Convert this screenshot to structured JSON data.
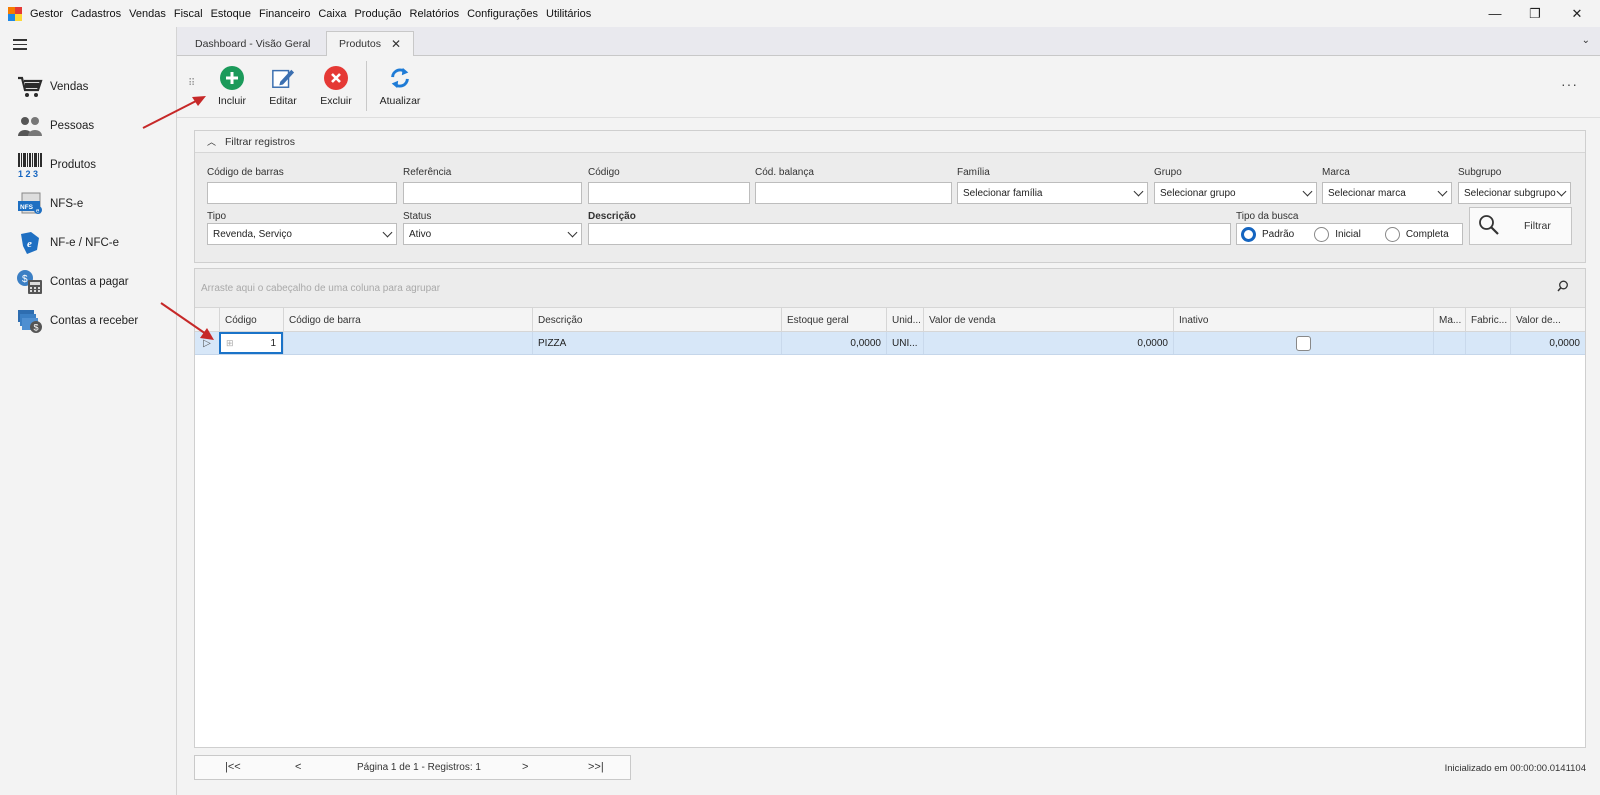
{
  "menubar": {
    "items": [
      "Gestor",
      "Cadastros",
      "Vendas",
      "Fiscal",
      "Estoque",
      "Financeiro",
      "Caixa",
      "Produção",
      "Relatórios",
      "Configurações",
      "Utilitários"
    ],
    "minimize": "—",
    "restore": "❐",
    "close": "✕"
  },
  "sidebar": {
    "items": [
      {
        "label": "Vendas",
        "icon": "shopping-cart-icon"
      },
      {
        "label": "Pessoas",
        "icon": "people-icon"
      },
      {
        "label": "Produtos",
        "icon": "barcode-icon"
      },
      {
        "label": "NFS-e",
        "icon": "nfse-icon"
      },
      {
        "label": "NF-e / NFC-e",
        "icon": "nfe-icon"
      },
      {
        "label": "Contas a pagar",
        "icon": "bill-pay-icon"
      },
      {
        "label": "Contas a receber",
        "icon": "bill-receive-icon"
      }
    ]
  },
  "tabs": {
    "items": [
      {
        "label": "Dashboard - Visão Geral",
        "active": false
      },
      {
        "label": "Produtos",
        "active": true,
        "close": "✕"
      }
    ],
    "dropdown": "⌄"
  },
  "toolbar": {
    "incluir": "Incluir",
    "editar": "Editar",
    "excluir": "Excluir",
    "atualizar": "Atualizar",
    "more": "···"
  },
  "filter": {
    "header": "Filtrar registros",
    "codigo_barras_label": "Código de barras",
    "codigo_barras_value": "",
    "referencia_label": "Referência",
    "referencia_value": "",
    "codigo_label": "Código",
    "codigo_value": "",
    "cod_balanca_label": "Cód. balança",
    "cod_balanca_value": "",
    "familia_label": "Família",
    "familia_value": "Selecionar família",
    "grupo_label": "Grupo",
    "grupo_value": "Selecionar grupo",
    "marca_label": "Marca",
    "marca_value": "Selecionar marca",
    "subgrupo_label": "Subgrupo",
    "subgrupo_value": "Selecionar subgrupo",
    "tipo_label": "Tipo",
    "tipo_value": "Revenda, Serviço",
    "status_label": "Status",
    "status_value": "Ativo",
    "descricao_label": "Descrição",
    "descricao_value": "",
    "tipo_busca_label": "Tipo da busca",
    "tipo_busca_options": [
      "Padrão",
      "Inicial",
      "Completa"
    ],
    "tipo_busca_selected": "Padrão",
    "filtrar_label": "Filtrar"
  },
  "grid": {
    "group_hint": "Arraste aqui o cabeçalho de uma coluna para agrupar",
    "columns": [
      "Código",
      "Código de barra",
      "Descrição",
      "Estoque geral",
      "Unid...",
      "Valor de venda",
      "Inativo",
      "Ma...",
      "Fabric...",
      "Valor de..."
    ],
    "rows": [
      {
        "codigo": "1",
        "codigo_barra": "",
        "descricao": "PIZZA",
        "estoque_geral": "0,0000",
        "unidade": "UNI...",
        "valor_venda": "0,0000",
        "inativo": false,
        "marca": "",
        "fabricante": "",
        "valor_de": "0,0000"
      }
    ]
  },
  "pager": {
    "first": "|<<",
    "prev": "<",
    "info": "Página 1 de 1 - Registros: 1",
    "next": ">",
    "last": ">>|"
  },
  "status": {
    "text": "Inicializado em 00:00:00.0141104"
  },
  "colors": {
    "add_green": "#1b9a5a",
    "delete_red": "#e53935",
    "refresh_blue": "#1e7bd6",
    "selected_row": "#d7e7f8",
    "annotation_arrow": "#c62828"
  }
}
